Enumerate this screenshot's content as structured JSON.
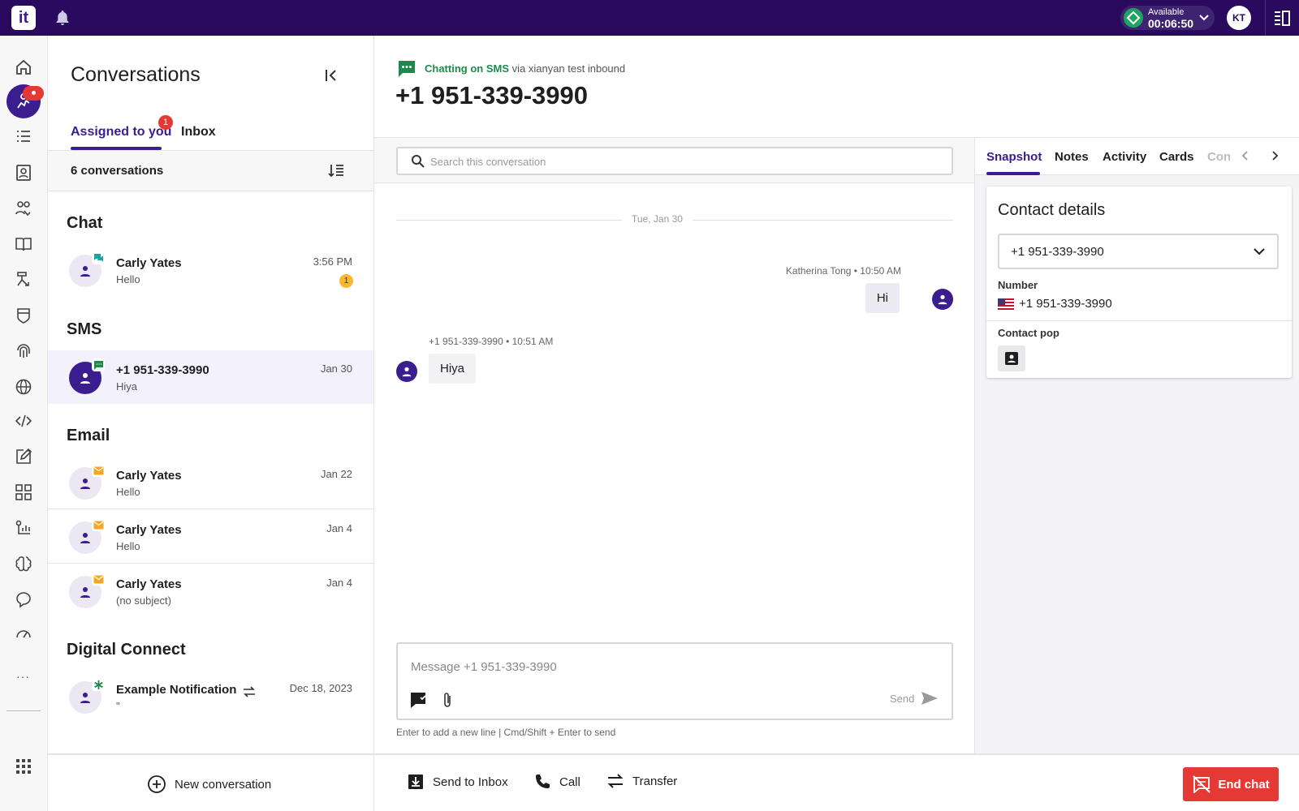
{
  "topbar": {
    "logo_text": "it",
    "status_label": "Available",
    "status_timer": "00:06:50",
    "avatar_initials": "KT"
  },
  "conversations": {
    "title": "Conversations",
    "tabs": [
      {
        "label": "Assigned to you",
        "badge": "1"
      },
      {
        "label": "Inbox"
      }
    ],
    "count_label": "6 conversations",
    "sections": {
      "chat": "Chat",
      "sms": "SMS",
      "email": "Email",
      "digital": "Digital Connect"
    },
    "items": [
      {
        "name": "Carly Yates",
        "preview": "Hello",
        "time": "3:56 PM",
        "unread": "1",
        "channel": "chat-icon"
      },
      {
        "name": "+1 951-339-3990",
        "preview": "Hiya",
        "time": "Jan 30",
        "channel": "sms-icon"
      },
      {
        "name": "Carly Yates",
        "preview": "Hello",
        "time": "Jan 22",
        "channel": "email-icon"
      },
      {
        "name": "Carly Yates",
        "preview": "Hello",
        "time": "Jan 4",
        "channel": "email-icon"
      },
      {
        "name": "Carly Yates",
        "preview": "(no subject)",
        "time": "Jan 4",
        "channel": "email-icon"
      },
      {
        "name": "Example Notification",
        "preview": "\"",
        "time": "Dec 18, 2023",
        "channel": "digital-connect-icon"
      }
    ],
    "new_conversation": "New conversation"
  },
  "chat": {
    "channel_prefix": "Chatting on SMS",
    "channel_via": "via xianyan test inbound",
    "number": "+1 951-339-3990",
    "search_placeholder": "Search this conversation",
    "date_label": "Tue, Jan 30",
    "messages": [
      {
        "meta": "Katherina Tong • 10:50 AM",
        "text": "Hi",
        "direction": "outbound"
      },
      {
        "meta": "+1 951-339-3990 • 10:51 AM",
        "text": "Hiya",
        "direction": "inbound"
      }
    ],
    "composer_placeholder": "Message +1 951-339-3990",
    "send_label": "Send",
    "hint": "Enter to add a new line | Cmd/Shift + Enter to send"
  },
  "panel": {
    "tabs": [
      "Snapshot",
      "Notes",
      "Activity",
      "Cards",
      "Con"
    ],
    "card_title": "Contact details",
    "selected_contact": "+1 951-339-3990",
    "number_label": "Number",
    "number_value": "+1 951-339-3990",
    "contact_pop_label": "Contact pop"
  },
  "actions": {
    "send_to_inbox": "Send to Inbox",
    "call": "Call",
    "transfer": "Transfer",
    "end_chat": "End chat"
  },
  "colors": {
    "topbar": "#2a0a5e",
    "accent": "#3b1d8f",
    "sms_green": "#1c8a4a",
    "status_green": "#1fa463",
    "danger": "#e53935",
    "unread": "#f5b82e",
    "email_badge": "#f5a623"
  }
}
